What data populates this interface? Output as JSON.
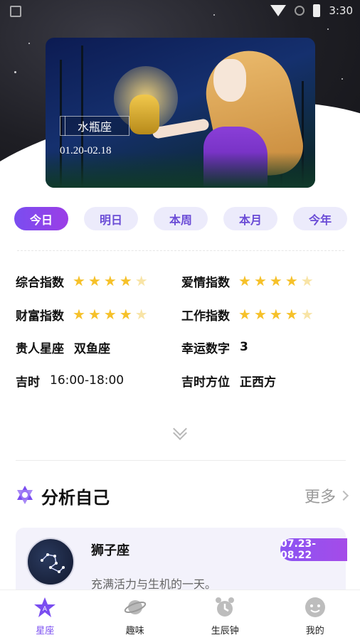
{
  "status_bar": {
    "time": "3:30"
  },
  "hero": {
    "sign_name": "水瓶座",
    "date_range": "01.20-02.18"
  },
  "tabs": [
    {
      "label": "今日",
      "active": true
    },
    {
      "label": "明日",
      "active": false
    },
    {
      "label": "本周",
      "active": false
    },
    {
      "label": "本月",
      "active": false
    },
    {
      "label": "今年",
      "active": false
    }
  ],
  "fortune": {
    "overall": {
      "label": "综合指数",
      "stars": 4,
      "max": 5
    },
    "love": {
      "label": "爱情指数",
      "stars": 4,
      "max": 5
    },
    "wealth": {
      "label": "财富指数",
      "stars": 4,
      "max": 5
    },
    "work": {
      "label": "工作指数",
      "stars": 4,
      "max": 5
    },
    "noble_sign": {
      "label": "贵人星座",
      "value": "双鱼座"
    },
    "lucky_number": {
      "label": "幸运数字",
      "value": "3"
    },
    "lucky_time": {
      "label": "吉时",
      "value": "16:00-18:00"
    },
    "lucky_direction": {
      "label": "吉时方位",
      "value": "正西方"
    }
  },
  "analyze": {
    "title": "分析自己",
    "more_label": "更多",
    "card": {
      "name": "狮子座",
      "date_range": "07.23-08.22",
      "description": "充满活力与生机的一天。"
    }
  },
  "nav": [
    {
      "label": "星座",
      "icon": "star-badge-icon",
      "active": true
    },
    {
      "label": "趣味",
      "icon": "planet-icon",
      "active": false
    },
    {
      "label": "生辰钟",
      "icon": "alarm-clock-icon",
      "active": false
    },
    {
      "label": "我的",
      "icon": "face-icon",
      "active": false
    }
  ],
  "colors": {
    "accent": "#7a4df0",
    "star": "#f6c12a",
    "star_dim": "#f8e4a6",
    "tab_bg": "#ecebfb"
  }
}
